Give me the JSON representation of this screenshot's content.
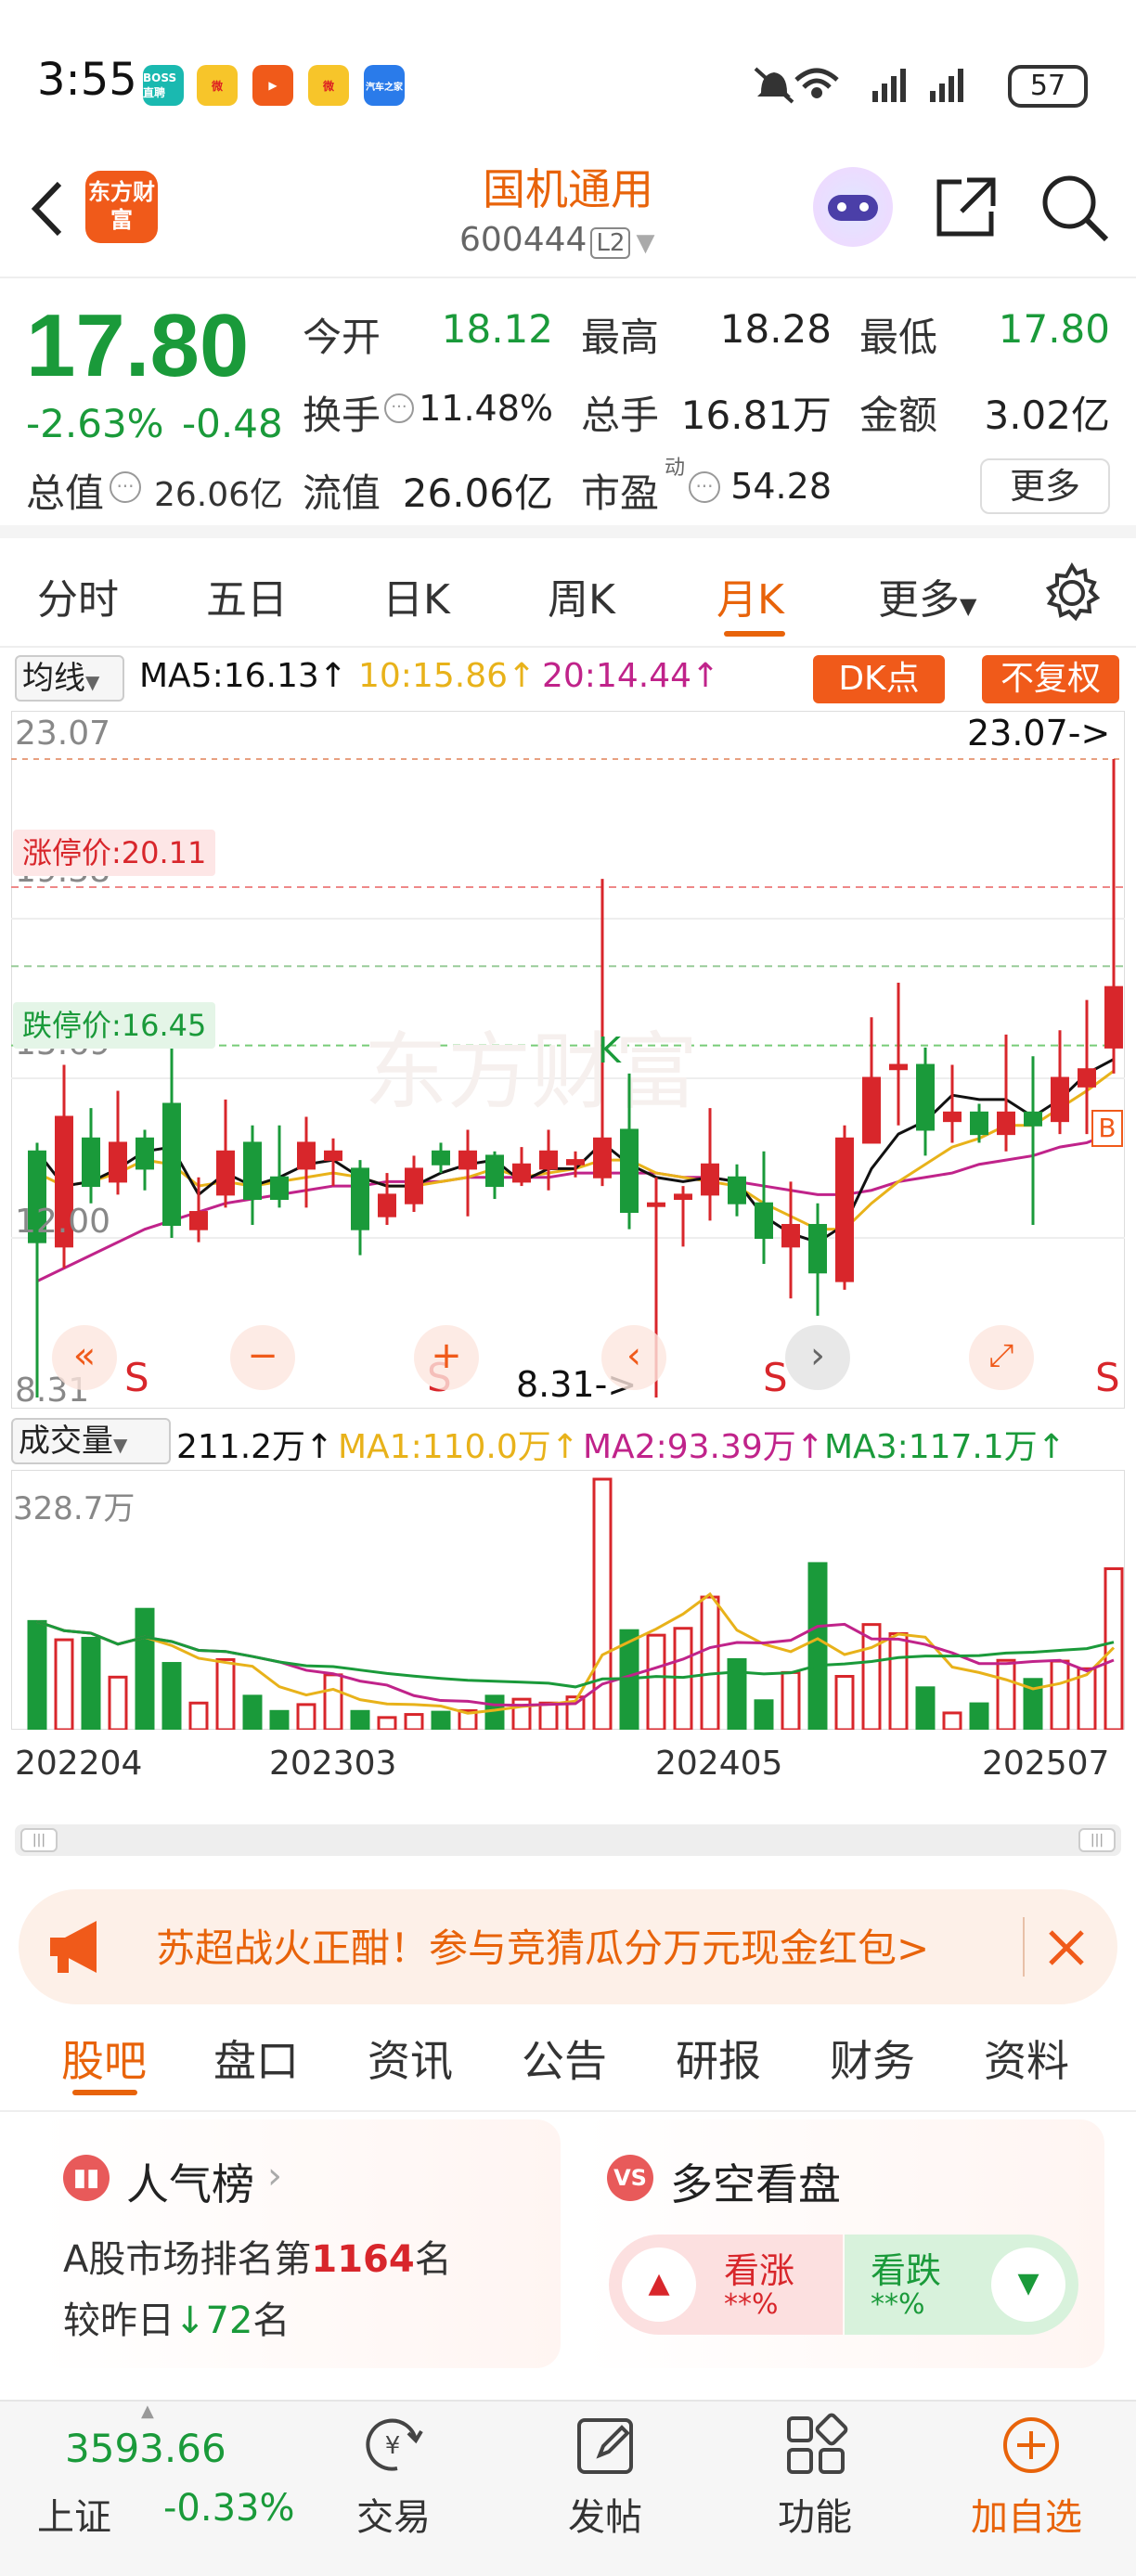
{
  "status_bar": {
    "time": "3:55",
    "apps": [
      "BOSS直聘",
      "微博",
      "快手",
      "微博",
      "汽车之家"
    ],
    "battery": "57"
  },
  "nav": {
    "back_icon": "chevron-left-icon",
    "logo_text": "东方财富",
    "stock_name": "国机通用",
    "stock_code": "600444",
    "level": "L2",
    "icons": [
      "robot-avatar-icon",
      "share-icon",
      "search-icon"
    ]
  },
  "quote": {
    "price": "17.80",
    "change_pct": "-2.63%",
    "change": "-0.48",
    "total_value_label": "总值",
    "total_value": "26.06亿",
    "fields": [
      {
        "label": "今开",
        "value": "18.12",
        "color": "green"
      },
      {
        "label": "最高",
        "value": "18.28",
        "color": "black"
      },
      {
        "label": "最低",
        "value": "17.80",
        "color": "green"
      },
      {
        "label": "换手",
        "value": "11.48%",
        "color": "black"
      },
      {
        "label": "总手",
        "value": "16.81万",
        "color": "black"
      },
      {
        "label": "金额",
        "value": "3.02亿",
        "color": "black"
      },
      {
        "label": "流值",
        "value": "26.06亿",
        "color": "black"
      },
      {
        "label": "市盈",
        "value": "54.28",
        "color": "black",
        "sup": "动"
      }
    ],
    "more_button": "更多"
  },
  "chart_tabs": {
    "items": [
      "分时",
      "五日",
      "日K",
      "周K",
      "月K",
      "更多"
    ],
    "active": "月K"
  },
  "ma_bar": {
    "selector": "均线",
    "ma5": "MA5:16.13↑",
    "ma10": "10:15.86↑",
    "ma20": "20:14.44↑",
    "dk_button": "DK点",
    "restore_button": "不复权"
  },
  "kline": {
    "price_labels": [
      "23.07",
      "19.38",
      "15.69",
      "12.00",
      "8.31"
    ],
    "limit_up_label": "涨停价:20.11",
    "limit_down_label": "跌停价:16.45",
    "max_marker": "23.07->",
    "min_marker": "8.31->",
    "k_marker": "K",
    "b_marker": "B",
    "s_marker": "S",
    "watermark": "东方财富",
    "colors": {
      "up": "#d8262b",
      "down": "#1a9a3a",
      "ma5": "#111111",
      "ma10": "#e8b21a",
      "ma20": "#c0238a"
    }
  },
  "volume": {
    "selector": "成交量",
    "current": "211.2万↑",
    "ma1": "MA1:110.0万↑",
    "ma2": "MA2:93.39万↑",
    "ma3": "MA3:117.1万↑",
    "max_label": "328.7万",
    "dates": [
      "202204",
      "202303",
      "202405",
      "202507"
    ]
  },
  "chart_data": {
    "type": "candlestick",
    "period": "monthly",
    "ylim": [
      8.31,
      23.07
    ],
    "candles": [
      {
        "o": 14.0,
        "c": 11.9,
        "h": 14.2,
        "l": 8.31
      },
      {
        "o": 11.8,
        "c": 14.8,
        "h": 16.0,
        "l": 11.3
      },
      {
        "o": 14.3,
        "c": 13.2,
        "h": 15.0,
        "l": 12.8
      },
      {
        "o": 13.3,
        "c": 14.2,
        "h": 15.4,
        "l": 13.0
      },
      {
        "o": 14.3,
        "c": 13.6,
        "h": 14.5,
        "l": 13.1
      },
      {
        "o": 15.1,
        "c": 12.3,
        "h": 16.5,
        "l": 12.0
      },
      {
        "o": 12.2,
        "c": 12.6,
        "h": 13.4,
        "l": 11.9
      },
      {
        "o": 13.0,
        "c": 14.0,
        "h": 15.2,
        "l": 12.7
      },
      {
        "o": 14.2,
        "c": 12.9,
        "h": 14.6,
        "l": 12.3
      },
      {
        "o": 13.4,
        "c": 12.9,
        "h": 14.6,
        "l": 12.7
      },
      {
        "o": 13.6,
        "c": 14.2,
        "h": 14.8,
        "l": 12.7
      },
      {
        "o": 13.8,
        "c": 14.0,
        "h": 14.3,
        "l": 13.2
      },
      {
        "o": 13.6,
        "c": 12.2,
        "h": 13.8,
        "l": 11.6
      },
      {
        "o": 12.5,
        "c": 13.0,
        "h": 13.5,
        "l": 12.3
      },
      {
        "o": 12.8,
        "c": 13.6,
        "h": 13.9,
        "l": 12.6
      },
      {
        "o": 14.0,
        "c": 13.7,
        "h": 14.2,
        "l": 13.5
      },
      {
        "o": 13.6,
        "c": 14.0,
        "h": 14.5,
        "l": 12.5
      },
      {
        "o": 13.9,
        "c": 13.2,
        "h": 14.0,
        "l": 12.9
      },
      {
        "o": 13.3,
        "c": 13.7,
        "h": 14.1,
        "l": 13.2
      },
      {
        "o": 13.6,
        "c": 14.0,
        "h": 14.5,
        "l": 13.1
      },
      {
        "o": 13.7,
        "c": 13.8,
        "h": 14.0,
        "l": 13.4
      },
      {
        "o": 13.4,
        "c": 14.3,
        "h": 20.3,
        "l": 13.2
      },
      {
        "o": 14.5,
        "c": 12.6,
        "h": 15.8,
        "l": 12.2
      },
      {
        "o": 12.8,
        "c": 12.8,
        "h": 13.4,
        "l": 8.31
      },
      {
        "o": 12.9,
        "c": 13.0,
        "h": 13.2,
        "l": 11.8
      },
      {
        "o": 13.0,
        "c": 13.7,
        "h": 15.0,
        "l": 12.4
      },
      {
        "o": 13.4,
        "c": 12.8,
        "h": 13.7,
        "l": 12.5
      },
      {
        "o": 12.8,
        "c": 12.0,
        "h": 14.0,
        "l": 11.4
      },
      {
        "o": 11.8,
        "c": 12.3,
        "h": 13.3,
        "l": 10.6
      },
      {
        "o": 12.3,
        "c": 11.2,
        "h": 12.8,
        "l": 10.2
      },
      {
        "o": 11.0,
        "c": 14.3,
        "h": 14.6,
        "l": 10.8
      },
      {
        "o": 14.2,
        "c": 15.7,
        "h": 17.1,
        "l": 14.2
      },
      {
        "o": 15.9,
        "c": 16.0,
        "h": 17.9,
        "l": 14.6
      },
      {
        "o": 16.0,
        "c": 14.5,
        "h": 16.4,
        "l": 13.9
      },
      {
        "o": 14.7,
        "c": 14.9,
        "h": 16.0,
        "l": 14.2
      },
      {
        "o": 14.9,
        "c": 14.4,
        "h": 15.1,
        "l": 14.2
      },
      {
        "o": 14.4,
        "c": 14.9,
        "h": 16.7,
        "l": 14.0
      },
      {
        "o": 14.9,
        "c": 14.6,
        "h": 16.2,
        "l": 12.3
      },
      {
        "o": 14.7,
        "c": 15.7,
        "h": 16.8,
        "l": 14.4
      },
      {
        "o": 15.5,
        "c": 15.9,
        "h": 17.5,
        "l": 14.4
      },
      {
        "o": 16.4,
        "c": 17.8,
        "h": 23.07,
        "l": 15.8
      }
    ],
    "ma5": [
      14.0,
      13.2,
      13.3,
      13.6,
      14.0,
      14.1,
      13.0,
      13.5,
      13.2,
      13.4,
      13.7,
      13.8,
      13.4,
      13.2,
      13.2,
      13.5,
      13.7,
      13.8,
      13.3,
      13.6,
      13.6,
      14.2,
      13.7,
      13.4,
      13.3,
      13.4,
      13.3,
      12.5,
      12.1,
      11.9,
      12.3,
      13.6,
      14.4,
      14.7,
      15.3,
      15.2,
      15.2,
      14.8,
      15.2,
      15.8,
      16.13
    ],
    "ma10": [
      13.5,
      13.2,
      13.3,
      13.5,
      13.8,
      13.7,
      13.2,
      13.3,
      13.2,
      13.3,
      13.4,
      13.5,
      13.4,
      13.2,
      13.2,
      13.3,
      13.4,
      13.6,
      13.4,
      13.5,
      13.6,
      13.8,
      13.8,
      13.5,
      13.4,
      13.3,
      13.2,
      12.8,
      12.5,
      12.2,
      12.2,
      12.8,
      13.3,
      13.7,
      14.1,
      14.3,
      14.6,
      14.6,
      15.0,
      15.4,
      15.86
    ],
    "ma20": [
      11.0,
      11.3,
      11.6,
      11.9,
      12.2,
      12.4,
      12.6,
      12.8,
      12.9,
      13.0,
      13.1,
      13.2,
      13.2,
      13.3,
      13.3,
      13.3,
      13.4,
      13.4,
      13.4,
      13.4,
      13.5,
      13.5,
      13.5,
      13.5,
      13.4,
      13.4,
      13.3,
      13.2,
      13.1,
      13.0,
      13.0,
      13.1,
      13.3,
      13.4,
      13.5,
      13.7,
      13.8,
      13.9,
      14.1,
      14.2,
      14.44
    ],
    "volume": [
      142.0,
      118.0,
      120.0,
      69.0,
      158.0,
      87.0,
      35.0,
      92.0,
      44.0,
      24.0,
      33.0,
      72.0,
      24.0,
      16.0,
      20.0,
      23.0,
      25.0,
      44.0,
      40.0,
      35.0,
      43.0,
      328.7,
      130.0,
      124.0,
      133.0,
      174.0,
      92.0,
      38.0,
      75.0,
      218.0,
      70.0,
      138.0,
      126.0,
      55.0,
      22.0,
      34.0,
      91.0,
      66.0,
      90.0,
      80.0,
      211.2
    ],
    "volume_ylim": [
      0,
      328.7
    ]
  },
  "banner": {
    "text": "苏超战火正酣！参与竞猜瓜分万元现金红包>",
    "icon": "megaphone-icon",
    "close_icon": "close-icon"
  },
  "sub_tabs": {
    "items": [
      "股吧",
      "盘口",
      "资讯",
      "公告",
      "研报",
      "财务",
      "资料"
    ],
    "active": "股吧"
  },
  "popularity": {
    "title": "人气榜",
    "rank_prefix": "A股市场排名第",
    "rank": "1164",
    "rank_suffix": "名",
    "change_prefix": "较昨日",
    "change_value": "72",
    "change_suffix": "名"
  },
  "bull_bear": {
    "title": "多空看盘",
    "bull_label": "看涨",
    "bull_value": "**%",
    "bear_label": "看跌",
    "bear_value": "**%"
  },
  "bottom_bar": {
    "index_value": "3593.66",
    "index_name": "上证",
    "index_change": "-0.33%",
    "items": [
      {
        "label": "交易",
        "icon": "yuan-exchange-icon"
      },
      {
        "label": "发帖",
        "icon": "edit-icon"
      },
      {
        "label": "功能",
        "icon": "grid-icon"
      },
      {
        "label": "加自选",
        "icon": "plus-circle-icon"
      }
    ]
  }
}
